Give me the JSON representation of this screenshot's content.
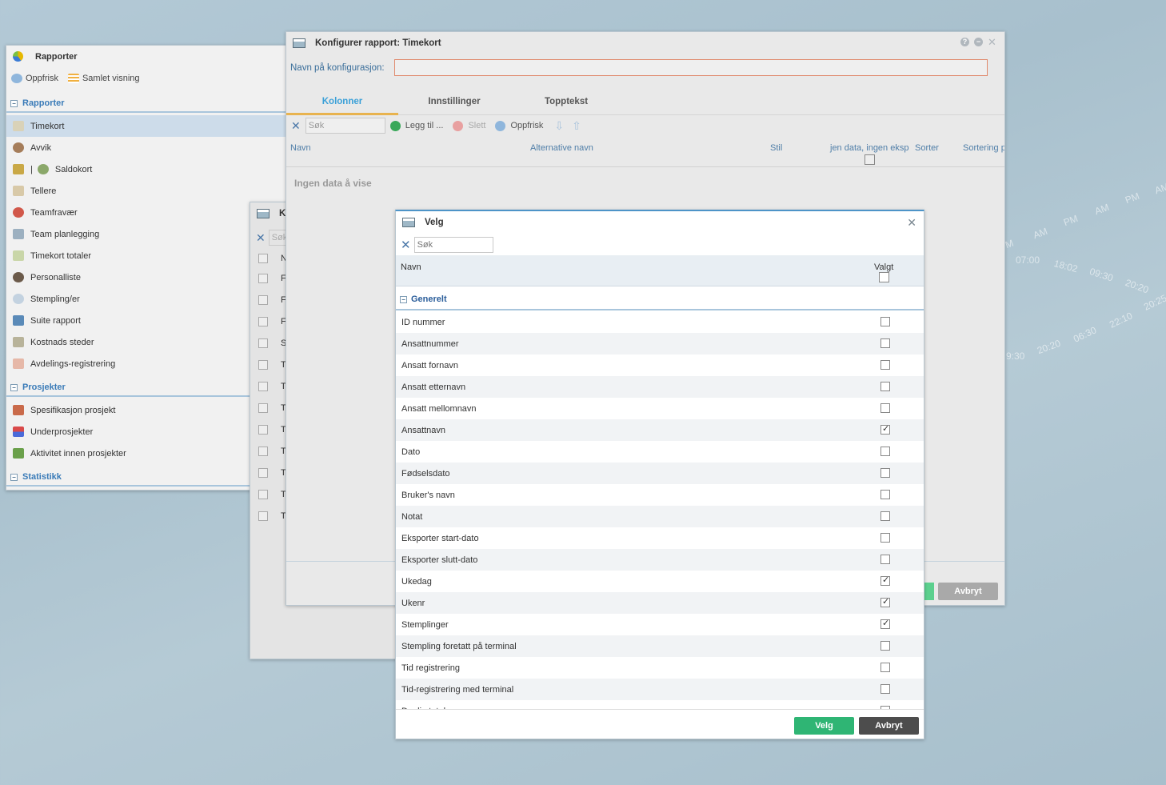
{
  "reports": {
    "title": "Rapporter",
    "toolbar": {
      "refresh": "Oppfrisk",
      "combined": "Samlet visning"
    },
    "groups": [
      {
        "label": "Rapporter"
      },
      {
        "label": "Prosjekter"
      },
      {
        "label": "Statistikk"
      }
    ],
    "items": [
      "Timekort",
      "Avvik",
      "Saldokort",
      "Tellere",
      "Teamfravær",
      "Team planlegging",
      "Timekort totaler",
      "Personalliste",
      "Stempling/er",
      "Suite rapport",
      "Kostnads steder",
      "Avdelings-registrering"
    ],
    "item_separator": "|",
    "project_items": [
      "Spesifikasjon prosjekt",
      "Underprosjekter",
      "Aktivitet innen prosjekter"
    ]
  },
  "bg_window": {
    "title": "K",
    "search_placeholder": "Søk",
    "row_initials": [
      "N",
      "F",
      "F",
      "F",
      "S",
      "T",
      "T",
      "T",
      "T",
      "T",
      "T",
      "T",
      "T"
    ]
  },
  "config": {
    "title": "Konfigurer rapport: Timekort",
    "name_label": "Navn på konfigurasjon:",
    "name_value": "",
    "tabs": [
      "Kolonner",
      "Innstillinger",
      "Topptekst"
    ],
    "toolbar": {
      "search_placeholder": "Søk",
      "add": "Legg til ...",
      "delete": "Slett",
      "refresh": "Oppfrisk"
    },
    "columns": [
      "Navn",
      "Alternative navn",
      "Stil",
      "jen data, ingen eksp",
      "Sorter",
      "Sortering p"
    ],
    "no_data": "Ingen data å vise",
    "cancel": "Avbryt"
  },
  "velg": {
    "title": "Velg",
    "search_placeholder": "Søk",
    "col_name": "Navn",
    "col_selected": "Valgt",
    "group": "Generelt",
    "rows": [
      {
        "label": "ID nummer",
        "checked": false
      },
      {
        "label": "Ansattnummer",
        "checked": false
      },
      {
        "label": "Ansatt fornavn",
        "checked": false
      },
      {
        "label": "Ansatt etternavn",
        "checked": false
      },
      {
        "label": "Ansatt mellomnavn",
        "checked": false
      },
      {
        "label": "Ansattnavn",
        "checked": true
      },
      {
        "label": "Dato",
        "checked": false
      },
      {
        "label": "Fødselsdato",
        "checked": false
      },
      {
        "label": "Bruker's navn",
        "checked": false
      },
      {
        "label": "Notat",
        "checked": false
      },
      {
        "label": "Eksporter start-dato",
        "checked": false
      },
      {
        "label": "Eksporter slutt-dato",
        "checked": false
      },
      {
        "label": "Ukedag",
        "checked": true
      },
      {
        "label": "Ukenr",
        "checked": true
      },
      {
        "label": "Stemplinger",
        "checked": true
      },
      {
        "label": "Stempling foretatt på terminal",
        "checked": false
      },
      {
        "label": "Tid registrering",
        "checked": false
      },
      {
        "label": "Tid-registrering med terminal",
        "checked": false
      },
      {
        "label": "Daglig totaler",
        "checked": false
      }
    ],
    "ok": "Velg",
    "cancel": "Avbryt"
  },
  "decor": {
    "clock_labels": [
      "AM",
      "PM",
      "AM",
      "PM",
      "AM",
      "07:00",
      "18:02",
      "09:30",
      "20:20",
      "22:10",
      "06:30",
      "20:20",
      "9:30",
      "20:25",
      "M"
    ]
  },
  "colors": {
    "accent": "#3aa0d8",
    "ok": "#2fb574",
    "cancel": "#4d4d4d",
    "group": "#3a7bb8"
  }
}
